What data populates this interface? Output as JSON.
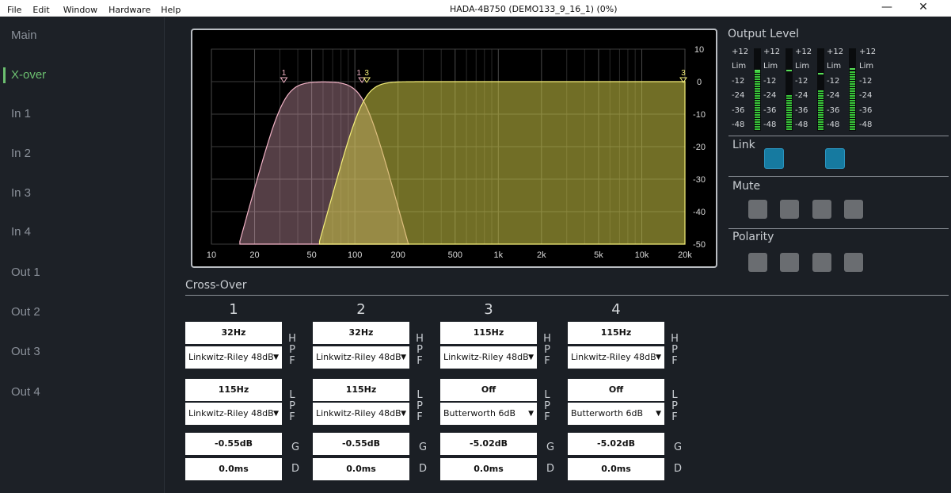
{
  "window": {
    "title": "HADA-4B750 (DEMO133_9_16_1) (0%)",
    "menu": [
      "File",
      "Edit",
      "Window",
      "Hardware",
      "Help"
    ],
    "minimize": "—",
    "close": "✕"
  },
  "sidebar": {
    "items": [
      "Main",
      "X-over",
      "In 1",
      "In 2",
      "In 3",
      "In 4",
      "Out 1",
      "Out 2",
      "Out 3",
      "Out 4"
    ],
    "active": "X-over"
  },
  "graph": {
    "x_ticks": [
      "10",
      "20",
      "50",
      "100",
      "200",
      "500",
      "1k",
      "2k",
      "5k",
      "10k",
      "20k"
    ],
    "y_ticks": [
      "10",
      "0",
      "-10",
      "-20",
      "-30",
      "-40",
      "-50"
    ],
    "markers": [
      "1",
      "1",
      "3",
      "3"
    ]
  },
  "chart_data": {
    "type": "area",
    "xscale": "log",
    "xlim": [
      10,
      20000
    ],
    "ylim": [
      -50,
      10
    ],
    "series": [
      {
        "hp": 32,
        "lp": 115,
        "color": "#f2b3c6"
      },
      {
        "hp": 115,
        "lp": 20000,
        "color": "#f5f07a"
      }
    ]
  },
  "crossover": {
    "title": "Cross-Over",
    "channels": [
      {
        "num": "1",
        "hpf_freq": "32Hz",
        "hpf_type": "Linkwitz-Riley 48dB",
        "lpf_freq": "115Hz",
        "lpf_type": "Linkwitz-Riley 48dB",
        "gain": "-0.55dB",
        "delay": "0.0ms"
      },
      {
        "num": "2",
        "hpf_freq": "32Hz",
        "hpf_type": "Linkwitz-Riley 48dB",
        "lpf_freq": "115Hz",
        "lpf_type": "Linkwitz-Riley 48dB",
        "gain": "-0.55dB",
        "delay": "0.0ms"
      },
      {
        "num": "3",
        "hpf_freq": "115Hz",
        "hpf_type": "Linkwitz-Riley 48dB",
        "lpf_freq": "Off",
        "lpf_type": "Butterworth 6dB",
        "gain": "-5.02dB",
        "delay": "0.0ms"
      },
      {
        "num": "4",
        "hpf_freq": "115Hz",
        "hpf_type": "Linkwitz-Riley 48dB",
        "lpf_freq": "Off",
        "lpf_type": "Butterworth 6dB",
        "gain": "-5.02dB",
        "delay": "0.0ms"
      }
    ],
    "labels": {
      "hpf": [
        "H",
        "P",
        "F"
      ],
      "lpf": [
        "L",
        "P",
        "F"
      ],
      "gain": "G",
      "delay": "D"
    }
  },
  "output": {
    "title": "Output Level",
    "scale": [
      "+12",
      "Lim",
      "-12",
      "-24",
      "-36",
      "-48"
    ],
    "levels": [
      0.72,
      0.42,
      0.5,
      0.72
    ],
    "peaks": [
      0.72,
      0.72,
      0.68,
      0.74
    ]
  },
  "link": {
    "title": "Link"
  },
  "mute": {
    "title": "Mute"
  },
  "polarity": {
    "title": "Polarity"
  }
}
